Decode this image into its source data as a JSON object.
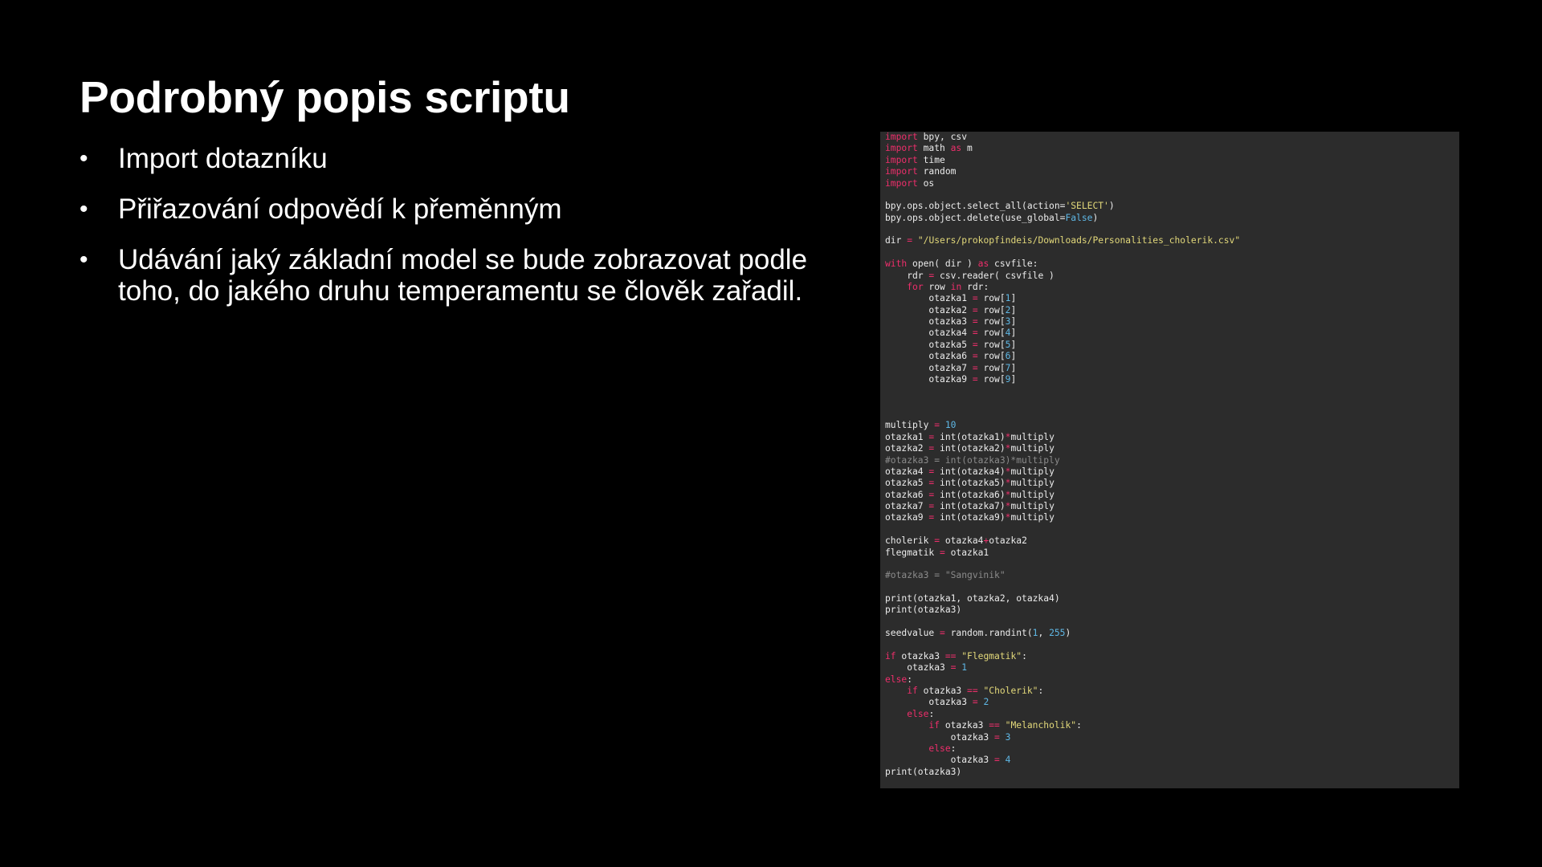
{
  "slide": {
    "title": "Podrobný popis scriptu",
    "bullet_glyph": "•",
    "bullets": [
      "Import dotazníku",
      "Přiřazování odpovědí k přeměnným",
      "Udávání jaký základní model se bude zobrazovat podle toho, do jakého druhu temperamentu se člověk zařadil."
    ]
  },
  "colors": {
    "background": "#000000",
    "text": "#ffffff",
    "code_background": "#2c2c2c",
    "code_keyword": "#ee2e6b",
    "code_string": "#e2d87a",
    "code_number": "#5fb8e6",
    "code_comment": "#8b8b8b"
  },
  "code": {
    "lines": [
      [
        [
          "kw",
          "import"
        ],
        [
          "id",
          " bpy, csv"
        ]
      ],
      [
        [
          "kw",
          "import"
        ],
        [
          "id",
          " math "
        ],
        [
          "kw",
          "as"
        ],
        [
          "id",
          " m"
        ]
      ],
      [
        [
          "kw",
          "import"
        ],
        [
          "id",
          " time"
        ]
      ],
      [
        [
          "kw",
          "import"
        ],
        [
          "id",
          " random"
        ]
      ],
      [
        [
          "kw",
          "import"
        ],
        [
          "id",
          " os"
        ]
      ],
      [],
      [
        [
          "id",
          "bpy.ops.object.select_all(action="
        ],
        [
          "str",
          "'SELECT'"
        ],
        [
          "id",
          ")"
        ]
      ],
      [
        [
          "id",
          "bpy.ops.object.delete(use_global="
        ],
        [
          "num",
          "False"
        ],
        [
          "id",
          ")"
        ]
      ],
      [],
      [
        [
          "id",
          "dir "
        ],
        [
          "op",
          "="
        ],
        [
          "id",
          " "
        ],
        [
          "str",
          "\"/Users/prokopfindeis/Downloads/Personalities_cholerik.csv\""
        ]
      ],
      [],
      [
        [
          "kw",
          "with"
        ],
        [
          "id",
          " open( dir ) "
        ],
        [
          "kw",
          "as"
        ],
        [
          "id",
          " csvfile:"
        ]
      ],
      [
        [
          "id",
          "    rdr "
        ],
        [
          "op",
          "="
        ],
        [
          "id",
          " csv.reader( csvfile )"
        ]
      ],
      [
        [
          "id",
          "    "
        ],
        [
          "kw",
          "for"
        ],
        [
          "id",
          " row "
        ],
        [
          "kw",
          "in"
        ],
        [
          "id",
          " rdr:"
        ]
      ],
      [
        [
          "id",
          "        otazka1 "
        ],
        [
          "op",
          "="
        ],
        [
          "id",
          " row["
        ],
        [
          "num",
          "1"
        ],
        [
          "id",
          "]"
        ]
      ],
      [
        [
          "id",
          "        otazka2 "
        ],
        [
          "op",
          "="
        ],
        [
          "id",
          " row["
        ],
        [
          "num",
          "2"
        ],
        [
          "id",
          "]"
        ]
      ],
      [
        [
          "id",
          "        otazka3 "
        ],
        [
          "op",
          "="
        ],
        [
          "id",
          " row["
        ],
        [
          "num",
          "3"
        ],
        [
          "id",
          "]"
        ]
      ],
      [
        [
          "id",
          "        otazka4 "
        ],
        [
          "op",
          "="
        ],
        [
          "id",
          " row["
        ],
        [
          "num",
          "4"
        ],
        [
          "id",
          "]"
        ]
      ],
      [
        [
          "id",
          "        otazka5 "
        ],
        [
          "op",
          "="
        ],
        [
          "id",
          " row["
        ],
        [
          "num",
          "5"
        ],
        [
          "id",
          "]"
        ]
      ],
      [
        [
          "id",
          "        otazka6 "
        ],
        [
          "op",
          "="
        ],
        [
          "id",
          " row["
        ],
        [
          "num",
          "6"
        ],
        [
          "id",
          "]"
        ]
      ],
      [
        [
          "id",
          "        otazka7 "
        ],
        [
          "op",
          "="
        ],
        [
          "id",
          " row["
        ],
        [
          "num",
          "7"
        ],
        [
          "id",
          "]"
        ]
      ],
      [
        [
          "id",
          "        otazka9 "
        ],
        [
          "op",
          "="
        ],
        [
          "id",
          " row["
        ],
        [
          "num",
          "9"
        ],
        [
          "id",
          "]"
        ]
      ],
      [],
      [],
      [],
      [
        [
          "id",
          "multiply "
        ],
        [
          "op",
          "="
        ],
        [
          "id",
          " "
        ],
        [
          "num",
          "10"
        ]
      ],
      [
        [
          "id",
          "otazka1 "
        ],
        [
          "op",
          "="
        ],
        [
          "id",
          " int(otazka1)"
        ],
        [
          "op",
          "*"
        ],
        [
          "id",
          "multiply"
        ]
      ],
      [
        [
          "id",
          "otazka2 "
        ],
        [
          "op",
          "="
        ],
        [
          "id",
          " int(otazka2)"
        ],
        [
          "op",
          "*"
        ],
        [
          "id",
          "multiply"
        ]
      ],
      [
        [
          "cmt",
          "#otazka3 = int(otazka3)*multiply"
        ]
      ],
      [
        [
          "id",
          "otazka4 "
        ],
        [
          "op",
          "="
        ],
        [
          "id",
          " int(otazka4)"
        ],
        [
          "op",
          "*"
        ],
        [
          "id",
          "multiply"
        ]
      ],
      [
        [
          "id",
          "otazka5 "
        ],
        [
          "op",
          "="
        ],
        [
          "id",
          " int(otazka5)"
        ],
        [
          "op",
          "*"
        ],
        [
          "id",
          "multiply"
        ]
      ],
      [
        [
          "id",
          "otazka6 "
        ],
        [
          "op",
          "="
        ],
        [
          "id",
          " int(otazka6)"
        ],
        [
          "op",
          "*"
        ],
        [
          "id",
          "multiply"
        ]
      ],
      [
        [
          "id",
          "otazka7 "
        ],
        [
          "op",
          "="
        ],
        [
          "id",
          " int(otazka7)"
        ],
        [
          "op",
          "*"
        ],
        [
          "id",
          "multiply"
        ]
      ],
      [
        [
          "id",
          "otazka9 "
        ],
        [
          "op",
          "="
        ],
        [
          "id",
          " int(otazka9)"
        ],
        [
          "op",
          "*"
        ],
        [
          "id",
          "multiply"
        ]
      ],
      [],
      [
        [
          "id",
          "cholerik "
        ],
        [
          "op",
          "="
        ],
        [
          "id",
          " otazka4"
        ],
        [
          "op",
          "+"
        ],
        [
          "id",
          "otazka2"
        ]
      ],
      [
        [
          "id",
          "flegmatik "
        ],
        [
          "op",
          "="
        ],
        [
          "id",
          " otazka1"
        ]
      ],
      [],
      [
        [
          "cmt",
          "#otazka3 = \"Sangvinik\""
        ]
      ],
      [],
      [
        [
          "id",
          "print(otazka1, otazka2, otazka4)"
        ]
      ],
      [
        [
          "id",
          "print(otazka3)"
        ]
      ],
      [],
      [
        [
          "id",
          "seedvalue "
        ],
        [
          "op",
          "="
        ],
        [
          "id",
          " random.randint("
        ],
        [
          "num",
          "1"
        ],
        [
          "id",
          ", "
        ],
        [
          "num",
          "255"
        ],
        [
          "id",
          ")"
        ]
      ],
      [],
      [
        [
          "kw",
          "if"
        ],
        [
          "id",
          " otazka3 "
        ],
        [
          "op",
          "=="
        ],
        [
          "id",
          " "
        ],
        [
          "str",
          "\"Flegmatik\""
        ],
        [
          "id",
          ":"
        ]
      ],
      [
        [
          "id",
          "    otazka3 "
        ],
        [
          "op",
          "="
        ],
        [
          "id",
          " "
        ],
        [
          "num",
          "1"
        ]
      ],
      [
        [
          "kw",
          "else"
        ],
        [
          "id",
          ":"
        ]
      ],
      [
        [
          "id",
          "    "
        ],
        [
          "kw",
          "if"
        ],
        [
          "id",
          " otazka3 "
        ],
        [
          "op",
          "=="
        ],
        [
          "id",
          " "
        ],
        [
          "str",
          "\"Cholerik\""
        ],
        [
          "id",
          ":"
        ]
      ],
      [
        [
          "id",
          "        otazka3 "
        ],
        [
          "op",
          "="
        ],
        [
          "id",
          " "
        ],
        [
          "num",
          "2"
        ]
      ],
      [
        [
          "id",
          "    "
        ],
        [
          "kw",
          "else"
        ],
        [
          "id",
          ":"
        ]
      ],
      [
        [
          "id",
          "        "
        ],
        [
          "kw",
          "if"
        ],
        [
          "id",
          " otazka3 "
        ],
        [
          "op",
          "=="
        ],
        [
          "id",
          " "
        ],
        [
          "str",
          "\"Melancholik\""
        ],
        [
          "id",
          ":"
        ]
      ],
      [
        [
          "id",
          "            otazka3 "
        ],
        [
          "op",
          "="
        ],
        [
          "id",
          " "
        ],
        [
          "num",
          "3"
        ]
      ],
      [
        [
          "id",
          "        "
        ],
        [
          "kw",
          "else"
        ],
        [
          "id",
          ":"
        ]
      ],
      [
        [
          "id",
          "            otazka3 "
        ],
        [
          "op",
          "="
        ],
        [
          "id",
          " "
        ],
        [
          "num",
          "4"
        ]
      ],
      [
        [
          "id",
          "print(otazka3)"
        ]
      ]
    ]
  }
}
